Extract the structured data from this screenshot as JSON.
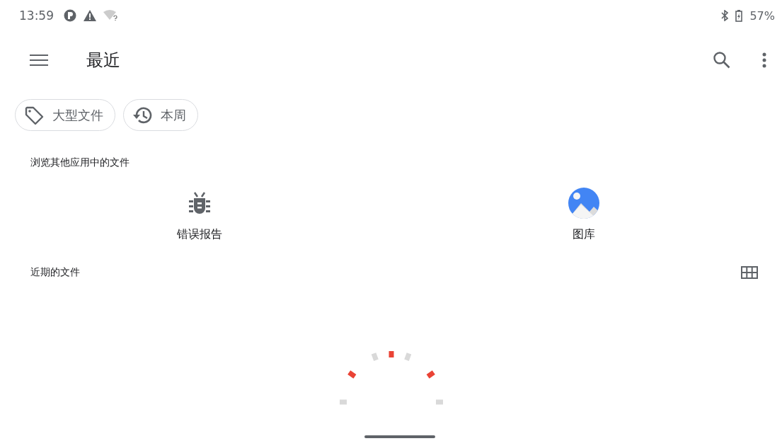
{
  "status_bar": {
    "time": "13:59",
    "battery": "57%"
  },
  "top_bar": {
    "title": "最近"
  },
  "chips": [
    {
      "label": "大型文件"
    },
    {
      "label": "本周"
    }
  ],
  "apps_section": {
    "title": "浏览其他应用中的文件",
    "apps": [
      {
        "label": "错误报告"
      },
      {
        "label": "图库"
      }
    ]
  },
  "recent_section": {
    "title": "近期的文件"
  }
}
